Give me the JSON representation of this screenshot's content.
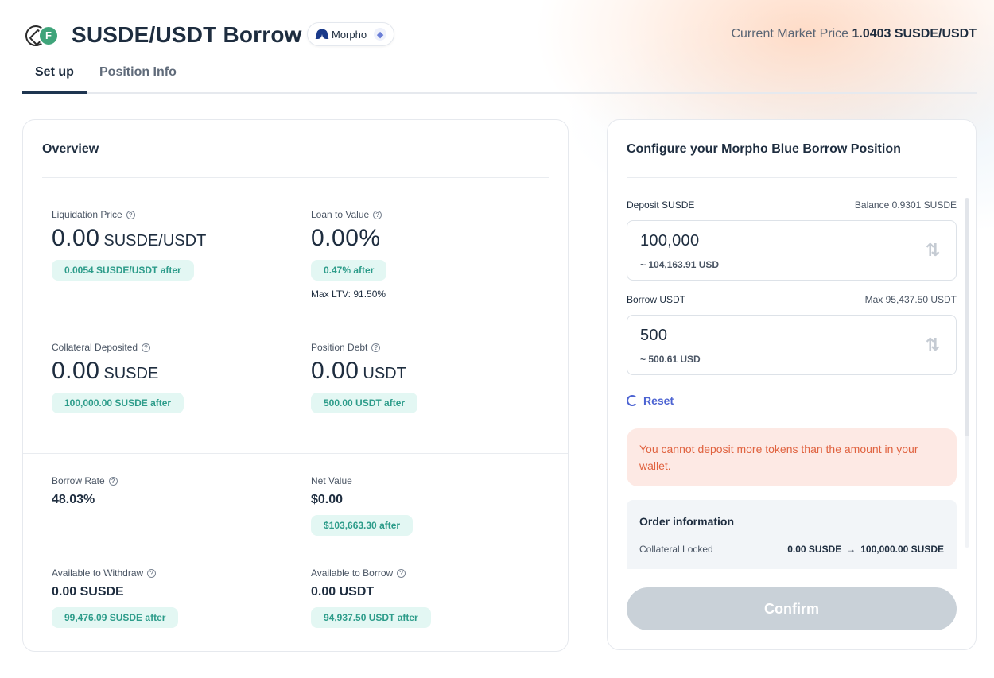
{
  "header": {
    "title": "SUSDE/USDT Borrow",
    "platform": "Morpho",
    "market_price_label": "Current Market Price",
    "market_price_value": "1.0403 SUSDE/USDT"
  },
  "tabs": [
    {
      "label": "Set up",
      "active": true
    },
    {
      "label": "Position Info",
      "active": false
    }
  ],
  "overview": {
    "title": "Overview",
    "liquidation_price": {
      "label": "Liquidation Price",
      "value": "0.00",
      "unit": "SUSDE/USDT",
      "after": "0.0054 SUSDE/USDT after"
    },
    "loan_to_value": {
      "label": "Loan to Value",
      "value": "0.00%",
      "after": "0.47% after",
      "max_ltv": "Max LTV: 91.50%"
    },
    "collateral_deposited": {
      "label": "Collateral Deposited",
      "value": "0.00",
      "unit": "SUSDE",
      "after": "100,000.00 SUSDE after"
    },
    "position_debt": {
      "label": "Position Debt",
      "value": "0.00",
      "unit": "USDT",
      "after": "500.00 USDT after"
    },
    "borrow_rate": {
      "label": "Borrow Rate",
      "value": "48.03%"
    },
    "net_value": {
      "label": "Net Value",
      "value": "$0.00",
      "after": "$103,663.30 after"
    },
    "available_withdraw": {
      "label": "Available to Withdraw",
      "value": "0.00 SUSDE",
      "after": "99,476.09 SUSDE after"
    },
    "available_borrow": {
      "label": "Available to Borrow",
      "value": "0.00 USDT",
      "after": "94,937.50 USDT after"
    }
  },
  "config": {
    "title": "Configure your Morpho Blue Borrow Position",
    "deposit": {
      "label": "Deposit SUSDE",
      "balance": "Balance 0.9301 SUSDE",
      "value": "100,000",
      "usd": "~ 104,163.91 USD"
    },
    "borrow": {
      "label": "Borrow USDT",
      "max": "Max 95,437.50 USDT",
      "value": "500",
      "usd": "~ 500.61 USD"
    },
    "reset_label": "Reset",
    "error": "You cannot deposit more tokens than the amount in your wallet.",
    "order": {
      "title": "Order information",
      "collateral_label": "Collateral Locked",
      "collateral_from": "0.00 SUSDE",
      "collateral_to": "100,000.00 SUSDE"
    },
    "confirm_label": "Confirm"
  },
  "icons": {
    "swap": "swap-vertical-icon",
    "help": "question-circle-icon",
    "reset": "refresh-icon",
    "network": "ethereum-icon"
  },
  "colors": {
    "accent": "#4c63d2",
    "pill_bg": "#e3f7f3",
    "pill_text": "#2d9c8a",
    "error_bg": "#fde9e4",
    "error_text": "#e0623f",
    "confirm_disabled": "#c9d1d8"
  }
}
